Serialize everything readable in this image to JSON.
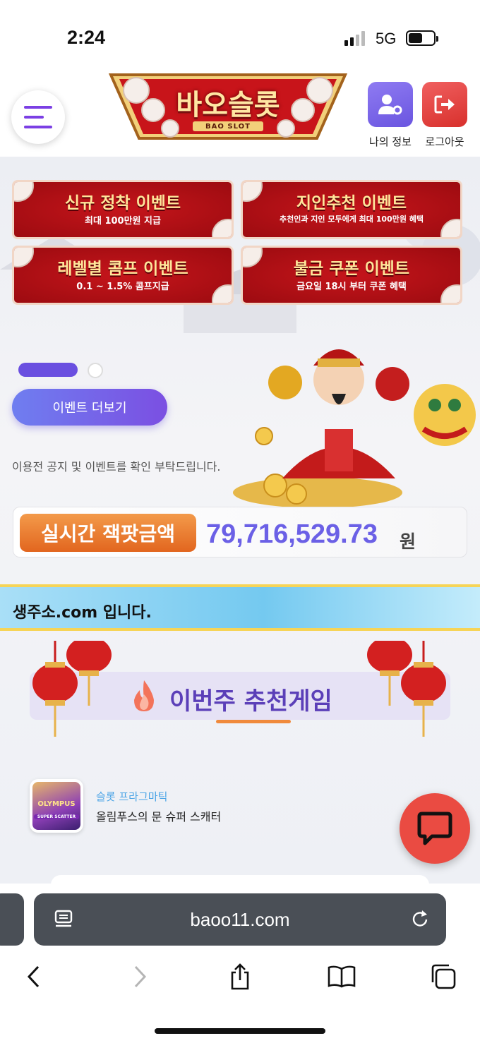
{
  "status": {
    "time": "2:24",
    "network": "5G"
  },
  "header": {
    "logo_text": "바오슬롯",
    "logo_sub": "BAO SLOT",
    "my_info_label": "나의 정보",
    "logout_label": "로그아웃"
  },
  "banners": [
    {
      "title": "신규 정착 이벤트",
      "subtitle": "최대 100만원 지급"
    },
    {
      "title": "지인추천 이벤트",
      "subtitle": "추천인과 지인 모두에게 최대 100만원 혜택"
    },
    {
      "title": "레벨별 콤프 이벤트",
      "subtitle": "0.1 ~ 1.5% 콤프지급"
    },
    {
      "title": "불금 쿠폰 이벤트",
      "subtitle": "금요일 18시 부터 쿠폰 혜택"
    }
  ],
  "carousel": {
    "page_count": 2,
    "active_index": 0
  },
  "event_more_button": "이벤트 더보기",
  "notice_text": "이용전 공지 및 이벤트를 확인 부탁드립니다.",
  "jackpot": {
    "label": "실시간 잭팟금액",
    "value": "79,716,529.73",
    "unit": "원"
  },
  "marquee_text": "생주소.com 입니다.",
  "recommended": {
    "title": "이번주 추천게임"
  },
  "games": [
    {
      "provider": "슬롯 프라그마틱",
      "name": "올림푸스의 문 슈퍼 스캐터",
      "thumb_text": "OLYMPUS",
      "thumb_sub": "SUPER SCATTER"
    }
  ],
  "browser": {
    "url": "baoo11.com"
  },
  "colors": {
    "accent": "#7b4fe2",
    "jackpot": "#6b60e6",
    "banner_red": "#c5151b",
    "chat": "#ea4b42"
  }
}
